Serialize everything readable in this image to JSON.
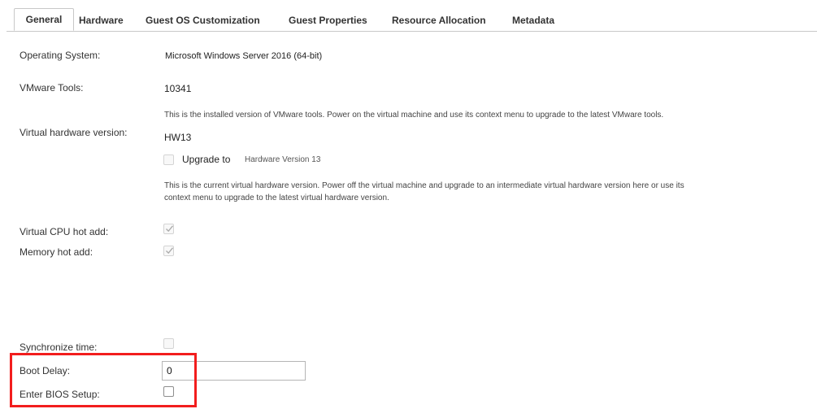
{
  "tabs": [
    {
      "label": "General"
    },
    {
      "label": "Hardware"
    },
    {
      "label": "Guest OS Customization"
    },
    {
      "label": "Guest Properties"
    },
    {
      "label": "Resource Allocation"
    },
    {
      "label": "Metadata"
    }
  ],
  "general": {
    "os_label": "Operating System:",
    "os_value": "Microsoft Windows Server 2016 (64-bit)",
    "tools_label": "VMware Tools:",
    "tools_value": "10341",
    "tools_help": "This is the installed version of VMware tools. Power on the virtual machine and use its context menu to upgrade to the latest VMware tools.",
    "hw_label": "Virtual hardware version:",
    "hw_value": "HW13",
    "upgrade_label": "Upgrade to",
    "upgrade_target": "Hardware Version 13",
    "hw_help_line1": "This is the current virtual hardware version. Power off the virtual machine and upgrade to an intermediate virtual hardware version here or use its",
    "hw_help_line2": "context menu to upgrade to the latest virtual hardware version.",
    "cpu_hot_add_label": "Virtual CPU hot add:",
    "cpu_hot_add_checked": true,
    "memory_hot_add_label": "Memory hot add:",
    "memory_hot_add_checked": true,
    "sync_time_label": "Synchronize time:",
    "sync_time_checked": false,
    "boot_delay_label": "Boot Delay:",
    "boot_delay_value": "0",
    "bios_setup_label": "Enter BIOS Setup:",
    "bios_setup_checked": false
  },
  "colors": {
    "highlight": "#f21d1d",
    "tab_border": "#c8c8c8"
  }
}
